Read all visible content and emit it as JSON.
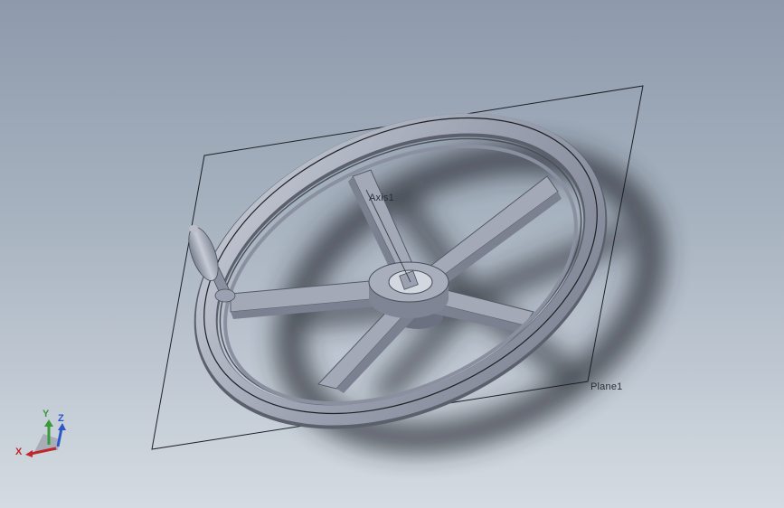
{
  "viewport": {
    "labels": {
      "axis": "Axis1",
      "plane": "Plane1"
    },
    "triad": {
      "x": "X",
      "y": "Y",
      "z": "Z"
    }
  },
  "colors": {
    "part": "#9da3b2",
    "part_dark": "#6b7180",
    "plane_edge": "#1e2026",
    "triad_x": "#c0262b",
    "triad_y": "#3a9a3a",
    "triad_z": "#2b57c8"
  }
}
